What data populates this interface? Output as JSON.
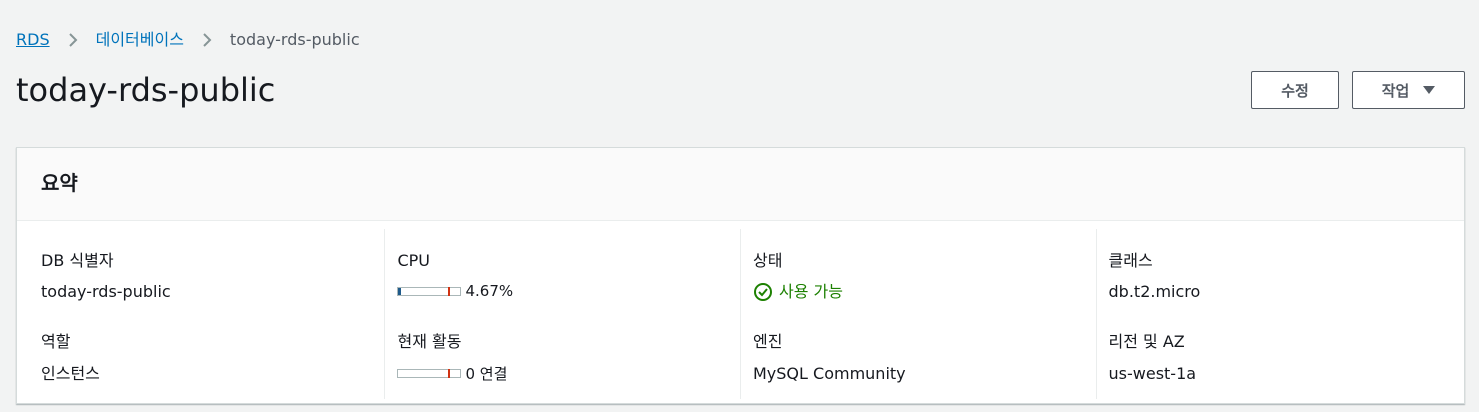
{
  "breadcrumb": {
    "items": [
      {
        "label": "RDS"
      },
      {
        "label": "데이터베이스"
      },
      {
        "label": "today-rds-public"
      }
    ]
  },
  "page": {
    "title": "today-rds-public"
  },
  "buttons": {
    "edit_label": "수정",
    "actions_label": "작업"
  },
  "summary": {
    "title": "요약",
    "db_identifier_label": "DB 식별자",
    "db_identifier_value": "today-rds-public",
    "role_label": "역할",
    "role_value": "인스턴스",
    "cpu_label": "CPU",
    "cpu_value": "4.67%",
    "cpu_fraction": 0.0467,
    "activity_label": "현재 활동",
    "activity_value": "0 연결",
    "activity_fraction": 0,
    "status_label": "상태",
    "status_value": "사용 가능",
    "engine_label": "엔진",
    "engine_value": "MySQL Community",
    "class_label": "클래스",
    "class_value": "db.t2.micro",
    "region_label": "리전 및 AZ",
    "region_value": "us-west-1a"
  },
  "icons": {
    "chevron": "chevron-right-icon",
    "caret": "caret-down-icon",
    "status": "status-positive-icon"
  },
  "colors": {
    "link": "#0073bb",
    "positive": "#1d8102",
    "meter_fill": "#1e5a8a",
    "meter_limit": "#d13212"
  }
}
